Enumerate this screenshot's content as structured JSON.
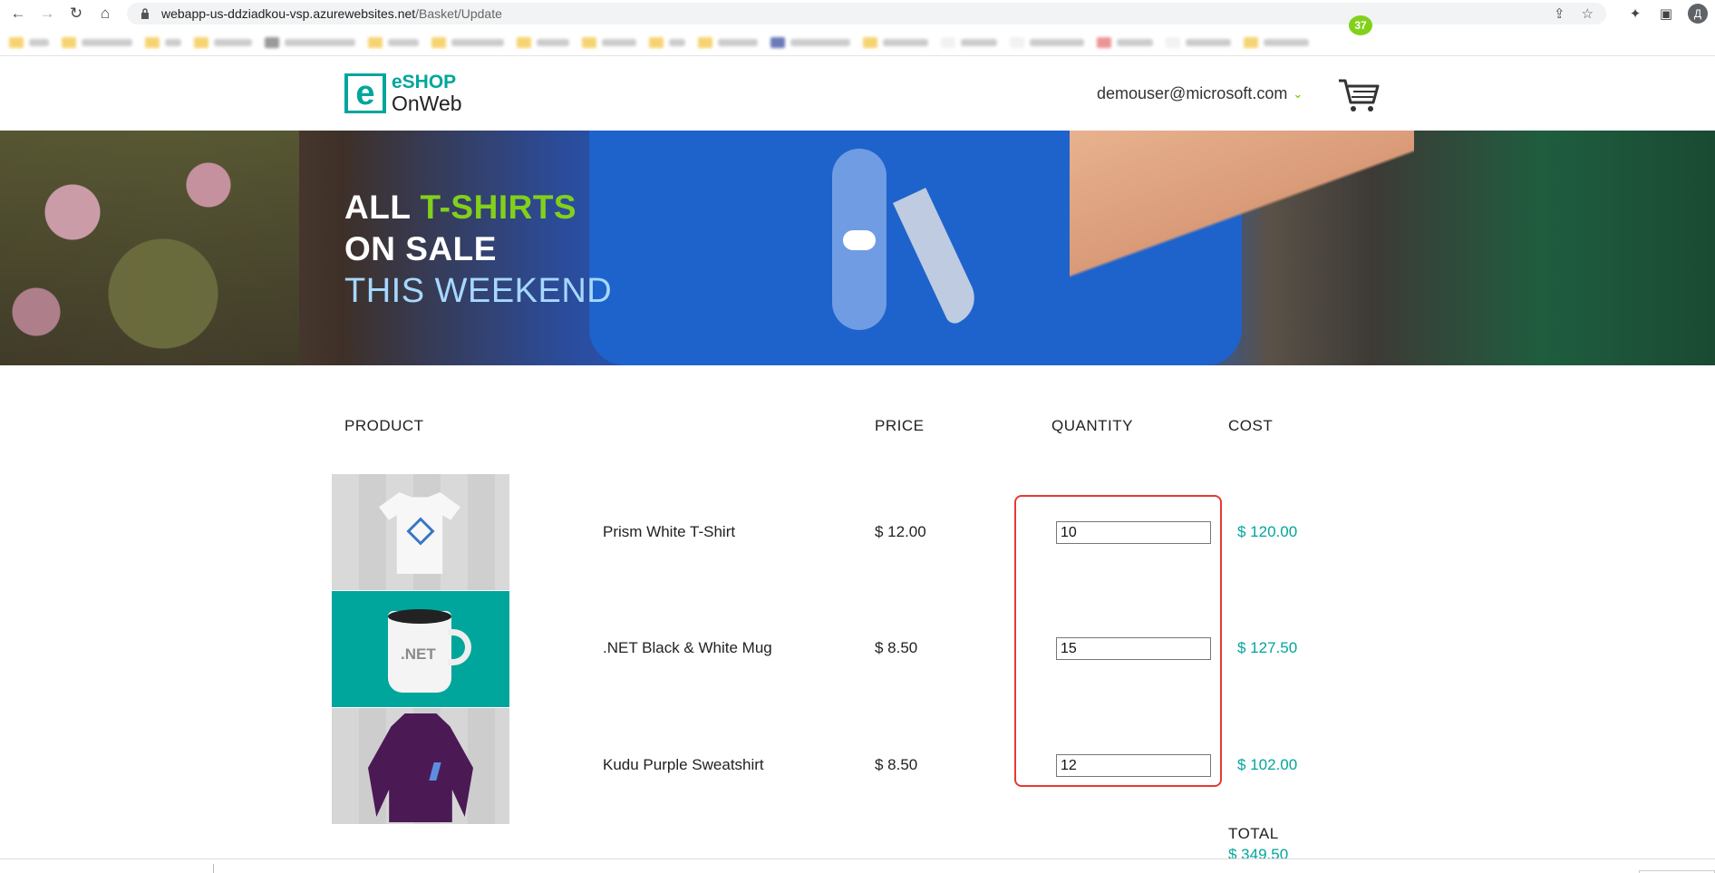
{
  "browser": {
    "url_host": "webapp-us-ddziadkou-vsp.azurewebsites.net",
    "url_path": "/Basket/Update",
    "profile_initial": "Д"
  },
  "header": {
    "logo_e": "e",
    "logo_line1": "eSHOP",
    "logo_line2": "OnWeb",
    "user_email": "demouser@microsoft.com",
    "cart_count": "37"
  },
  "hero": {
    "line1_a": "ALL ",
    "line1_b": "T-SHIRTS",
    "line2": "ON SALE",
    "line3": "THIS WEEKEND"
  },
  "basket": {
    "columns": {
      "product": "PRODUCT",
      "price": "PRICE",
      "quantity": "QUANTITY",
      "cost": "COST"
    },
    "items": [
      {
        "name": "Prism White T-Shirt",
        "price": "$ 12.00",
        "quantity": "10",
        "cost": "$ 120.00",
        "image": "tshirt-image"
      },
      {
        "name": ".NET Black & White Mug",
        "price": "$ 8.50",
        "quantity": "15",
        "cost": "$ 127.50",
        "image": "mug-image"
      },
      {
        "name": "Kudu Purple Sweatshirt",
        "price": "$ 8.50",
        "quantity": "12",
        "cost": "$ 102.00",
        "image": "sweatshirt-image"
      }
    ],
    "mug_print": ".NET",
    "total_label": "TOTAL",
    "total_value": "$ 349.50"
  },
  "colors": {
    "accent": "#00a69c",
    "brand_green": "#83d01b",
    "highlight": "#e53935"
  }
}
